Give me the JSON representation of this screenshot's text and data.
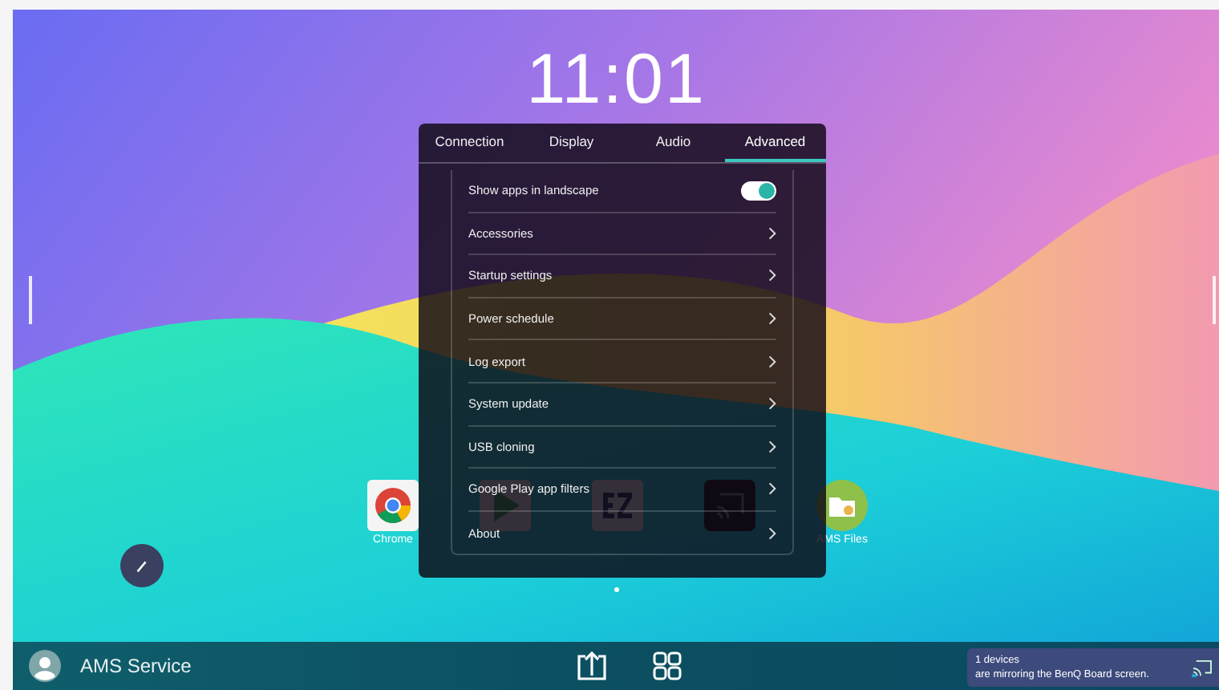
{
  "clock": "11:01",
  "settings": {
    "tabs": [
      {
        "label": "Connection",
        "selected": false
      },
      {
        "label": "Display",
        "selected": false
      },
      {
        "label": "Audio",
        "selected": false
      },
      {
        "label": "Advanced",
        "selected": true
      }
    ],
    "items": [
      {
        "kind": "toggle",
        "label": "Show apps in landscape",
        "on": true
      },
      {
        "kind": "link",
        "label": "Accessories"
      },
      {
        "kind": "link",
        "label": "Startup settings"
      },
      {
        "kind": "link",
        "label": "Power schedule"
      },
      {
        "kind": "link",
        "label": "Log export"
      },
      {
        "kind": "link",
        "label": "System update"
      },
      {
        "kind": "link",
        "label": "USB cloning"
      },
      {
        "kind": "link",
        "label": "Google Play app filters"
      },
      {
        "kind": "link",
        "label": "About"
      }
    ]
  },
  "apps": [
    {
      "kind": "chrome",
      "label": "Chrome"
    },
    {
      "kind": "play"
    },
    {
      "kind": "ez"
    },
    {
      "kind": "cast"
    },
    {
      "kind": "folder",
      "label": "AMS Files"
    }
  ],
  "user": {
    "name": "AMS Service"
  },
  "notification": {
    "lines": [
      "1 devices",
      "are mirroring the BenQ Board screen."
    ]
  }
}
